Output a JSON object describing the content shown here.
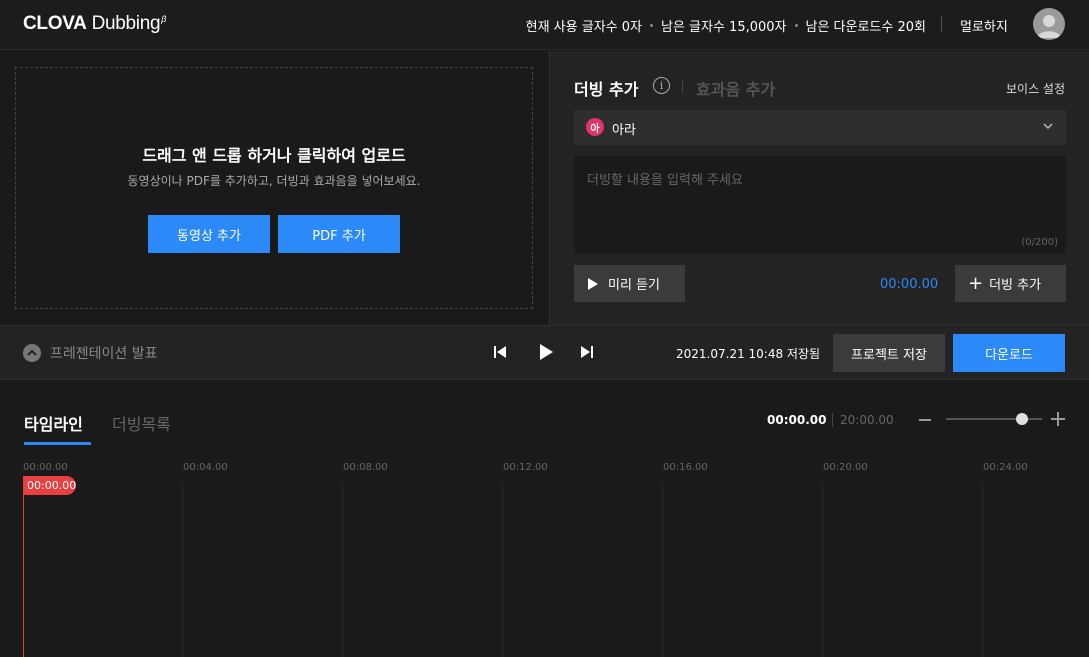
{
  "header": {
    "logo_main": "CLOVA",
    "logo_sub": "Dubbing",
    "logo_sup": "β",
    "stat_current": "현재 사용 글자수 0자",
    "stat_remaining_chars": "남은 글자수 15,000자",
    "stat_remaining_downloads": "남은 다운로드수 20회",
    "logout": "멀로하지"
  },
  "upload": {
    "title": "드래그 앤 드롭 하거나 클릭하여 업로드",
    "subtitle": "동영상이나 PDF를 추가하고, 더빙과 효과음을 넣어보세요.",
    "btn_video": "동영상 추가",
    "btn_pdf": "PDF 추가"
  },
  "dubbing": {
    "tab_active": "더빙 추가",
    "tab_inactive": "효과음 추가",
    "info_glyph": "i",
    "voice_setting": "보이스 설정",
    "voice_badge": "아",
    "voice_name": "아라",
    "placeholder": "더빙할 내용을 입력해 주세요",
    "char_count": "(0/200)",
    "btn_preview": "미리 듣기",
    "time": "00:00.00",
    "btn_add": "더빙 추가",
    "plus_glyph": "+"
  },
  "controls": {
    "presentation": "프레젠테이션 발표",
    "saved": "2021.07.21 10:48 저장됨",
    "btn_save": "프로젝트 저장",
    "btn_download": "다운로드"
  },
  "timeline": {
    "tab_active": "타임라인",
    "tab_inactive": "더빙목록",
    "current_time": "00:00.00",
    "total_time": "20:00.00",
    "zoom_level": 0.79,
    "ruler": [
      "00:00.00",
      "00:04.00",
      "00:08.00",
      "00:12.00",
      "00:16.00",
      "00:20.00",
      "00:24.00"
    ],
    "playhead": "00:00.00"
  },
  "colors": {
    "accent": "#2b8af7",
    "playhead": "#e84040",
    "voice_badge": "#e0336b"
  }
}
